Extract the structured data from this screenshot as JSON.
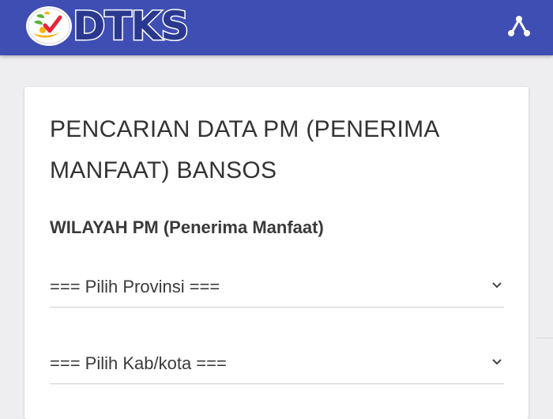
{
  "header": {
    "logo_text": "DTKS",
    "colors": {
      "bar": "#3f4eb3",
      "logo_dark": "#2a398f",
      "check": "#e8263a"
    },
    "share_icon": "share-icon"
  },
  "card": {
    "title": "PENCARIAN DATA PM (PENERIMA MANFAAT) BANSOS",
    "section_label": "WILAYAH PM (Penerima Manfaat)",
    "province_select": {
      "value": "=== Pilih Provinsi ==="
    },
    "city_select": {
      "value": "=== Pilih Kab/kota ==="
    }
  }
}
